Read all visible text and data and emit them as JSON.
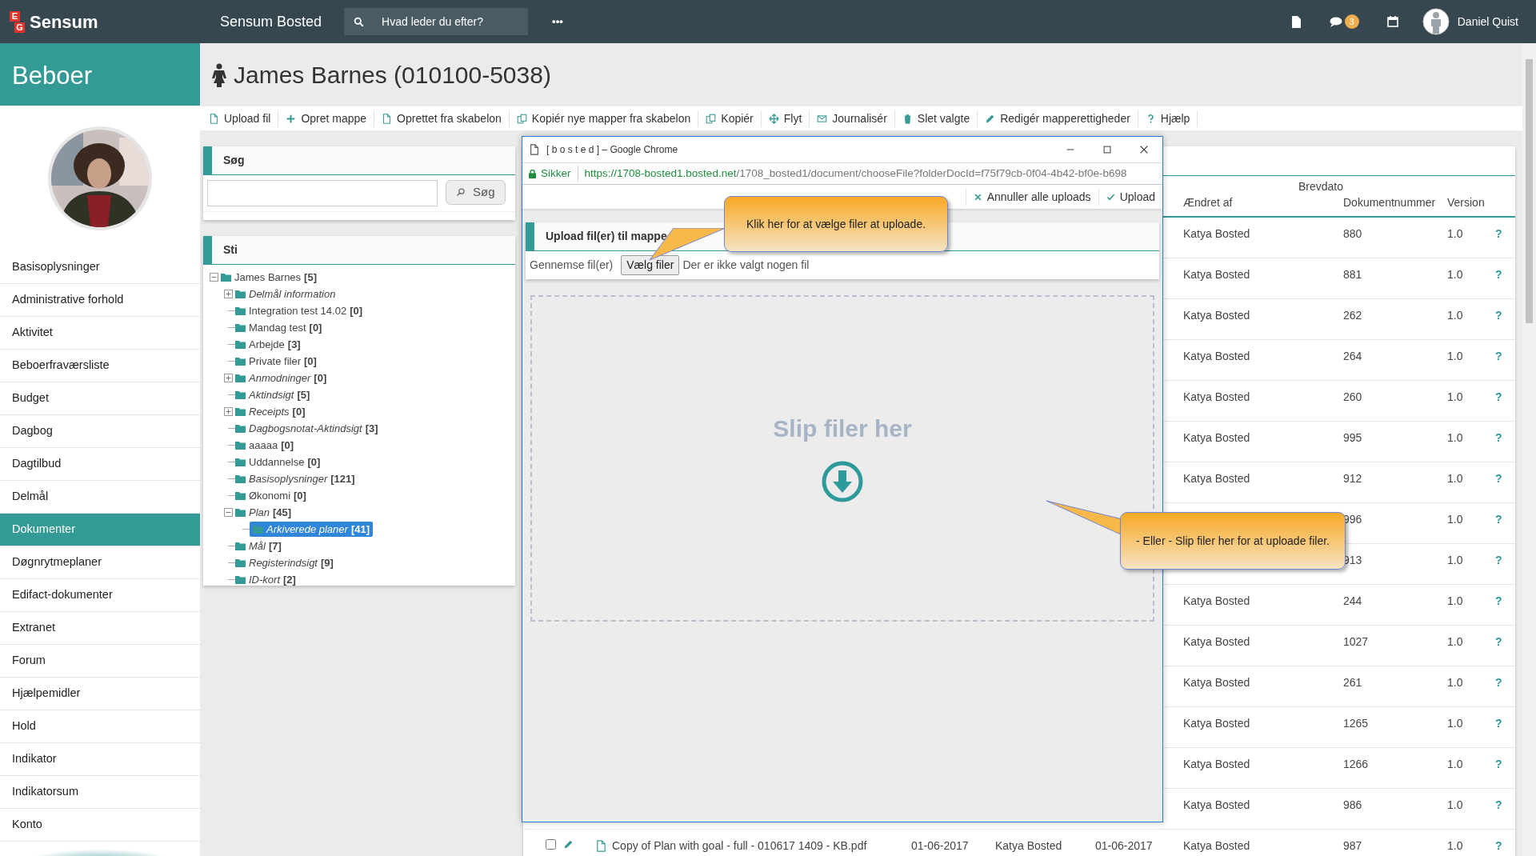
{
  "topbar": {
    "logo_letters": [
      "E",
      "G"
    ],
    "logo": "Sensum",
    "app_name": "Sensum Bosted",
    "search": {
      "placeholder": "Hvad leder du efter?"
    },
    "more": "•••",
    "chat_badge": "3",
    "user": "Daniel Quist"
  },
  "sidebar": {
    "title": "Beboer",
    "items": [
      {
        "label": "Basisoplysninger",
        "selected": false
      },
      {
        "label": "Administrative forhold",
        "selected": false
      },
      {
        "label": "Aktivitet",
        "selected": false
      },
      {
        "label": "Beboerfraværsliste",
        "selected": false
      },
      {
        "label": "Budget",
        "selected": false
      },
      {
        "label": "Dagbog",
        "selected": false
      },
      {
        "label": "Dagtilbud",
        "selected": false
      },
      {
        "label": "Delmål",
        "selected": false
      },
      {
        "label": "Dokumenter",
        "selected": true
      },
      {
        "label": "Døgnrytmeplaner",
        "selected": false
      },
      {
        "label": "Edifact-dokumenter",
        "selected": false
      },
      {
        "label": "Extranet",
        "selected": false
      },
      {
        "label": "Forum",
        "selected": false
      },
      {
        "label": "Hjælpemidler",
        "selected": false
      },
      {
        "label": "Hold",
        "selected": false
      },
      {
        "label": "Indikator",
        "selected": false
      },
      {
        "label": "Indikatorsum",
        "selected": false
      },
      {
        "label": "Konto",
        "selected": false
      }
    ]
  },
  "page": {
    "title": "James Barnes (010100-5038)",
    "toolbar": [
      {
        "label": "Upload fil"
      },
      {
        "label": "Opret mappe"
      },
      {
        "label": "Oprettet fra skabelon"
      },
      {
        "label": "Kopiér nye mapper fra skabelon"
      },
      {
        "label": "Kopiér"
      },
      {
        "label": "Flyt"
      },
      {
        "label": "Journalisér"
      },
      {
        "label": "Slet valgte"
      },
      {
        "label": "Redigér mapperettigheder"
      },
      {
        "label": "Hjælp"
      }
    ]
  },
  "search_panel": {
    "title": "Søg",
    "button": "Søg"
  },
  "path_panel": {
    "title": "Sti",
    "tree": [
      {
        "label": "James Barnes",
        "count": "[5]",
        "italic": false,
        "kind": "branch",
        "expanded": true,
        "selected": false,
        "children": [
          {
            "label": "Delmål information",
            "italic": true,
            "kind": "branch",
            "expanded": false,
            "selected": false
          },
          {
            "label": "Integration test 14.02",
            "count": "[0]",
            "italic": false,
            "kind": "leaf",
            "selected": false
          },
          {
            "label": "Mandag test",
            "count": "[0]",
            "italic": false,
            "kind": "leaf",
            "selected": false
          },
          {
            "label": "Arbejde",
            "count": "[3]",
            "italic": false,
            "kind": "leaf",
            "selected": false
          },
          {
            "label": "Private filer",
            "count": "[0]",
            "italic": false,
            "kind": "leaf",
            "selected": false
          },
          {
            "label": "Anmodninger",
            "count": "[0]",
            "italic": true,
            "kind": "branch",
            "expanded": false,
            "selected": false
          },
          {
            "label": "Aktindsigt",
            "count": "[5]",
            "italic": true,
            "kind": "leaf",
            "selected": false
          },
          {
            "label": "Receipts",
            "count": "[0]",
            "italic": true,
            "kind": "branch",
            "expanded": false,
            "selected": false
          },
          {
            "label": "Dagbogsnotat-Aktindsigt",
            "count": "[3]",
            "italic": true,
            "kind": "leaf",
            "selected": false
          },
          {
            "label": "aaaaa",
            "count": "[0]",
            "italic": false,
            "kind": "leaf",
            "selected": false
          },
          {
            "label": "Uddannelse",
            "count": "[0]",
            "italic": false,
            "kind": "leaf",
            "selected": false
          },
          {
            "label": "Basisoplysninger",
            "count": "[121]",
            "italic": true,
            "kind": "leaf",
            "selected": false
          },
          {
            "label": "Økonomi",
            "count": "[0]",
            "italic": false,
            "kind": "leaf",
            "selected": false
          },
          {
            "label": "Plan",
            "count": "[45]",
            "italic": true,
            "kind": "branch",
            "expanded": true,
            "selected": false,
            "children": [
              {
                "label": "Arkiverede planer",
                "count": "[41]",
                "italic": true,
                "kind": "leaf",
                "selected": true
              }
            ]
          },
          {
            "label": "Mål",
            "count": "[7]",
            "italic": true,
            "kind": "leaf",
            "selected": false
          },
          {
            "label": "Registerindsigt",
            "count": "[9]",
            "italic": true,
            "kind": "leaf",
            "selected": false
          },
          {
            "label": "ID-kort",
            "count": "[2]",
            "italic": true,
            "kind": "leaf",
            "selected": false
          }
        ]
      }
    ]
  },
  "table": {
    "header_top": "Brevdato",
    "columns": [
      "Ændret af",
      "Dokumentnummer",
      "Version"
    ],
    "rows": [
      {
        "author": "Katya Bosted",
        "number": "880",
        "version": "1.0",
        "help": "?"
      },
      {
        "author": "Katya Bosted",
        "number": "881",
        "version": "1.0",
        "help": "?"
      },
      {
        "author": "Katya Bosted",
        "number": "262",
        "version": "1.0",
        "help": "?"
      },
      {
        "author": "Katya Bosted",
        "number": "264",
        "version": "1.0",
        "help": "?"
      },
      {
        "author": "Katya Bosted",
        "number": "260",
        "version": "1.0",
        "help": "?"
      },
      {
        "author": "Katya Bosted",
        "number": "995",
        "version": "1.0",
        "help": "?"
      },
      {
        "author": "Katya Bosted",
        "number": "912",
        "version": "1.0",
        "help": "?"
      },
      {
        "number": "996",
        "version": "1.0",
        "help": "?"
      },
      {
        "number": "913",
        "version": "1.0",
        "help": "?"
      },
      {
        "author": "Katya Bosted",
        "number": "244",
        "version": "1.0",
        "help": "?"
      },
      {
        "author": "Katya Bosted",
        "number": "1027",
        "version": "1.0",
        "help": "?"
      },
      {
        "author": "Katya Bosted",
        "number": "261",
        "version": "1.0",
        "help": "?"
      },
      {
        "author": "Katya Bosted",
        "number": "1265",
        "version": "1.0",
        "help": "?"
      },
      {
        "author": "Katya Bosted",
        "number": "1266",
        "version": "1.0",
        "help": "?"
      },
      {
        "author": "Katya Bosted",
        "number": "986",
        "version": "1.0",
        "help": "?"
      },
      {
        "checked": false,
        "name": "Copy of Plan with goal - full - 010617 1409 - KB.pdf",
        "date": "01-06-2017",
        "created_by": "Katya Bosted",
        "letter_date": "01-06-2017",
        "author": "Katya Bosted",
        "number": "987",
        "version": "1.0",
        "help": "?"
      }
    ]
  },
  "dialog": {
    "title": "[ b o s t e d ] – Google Chrome",
    "secure": "Sikker",
    "url_host": "https://1708-bosted1.bosted.net",
    "url_path": "/1708_bosted1/document/chooseFile?folderDocId=f75f79cb-0f04-4b42-bf0e-b698",
    "actions": [
      {
        "label": "Annuller alle uploads"
      },
      {
        "label": "Upload"
      }
    ],
    "panel_title": "Upload fil(er) til mappe",
    "browse_label": "Gennemse fil(er)",
    "choose_button": "Vælg filer",
    "no_file": "Der er ikke valgt nogen fil",
    "drop_text": "Slip filer her"
  },
  "tooltips": [
    "Klik her for at vælge filer at uploade.",
    "- Eller - Slip filer her for at uploade filer."
  ]
}
